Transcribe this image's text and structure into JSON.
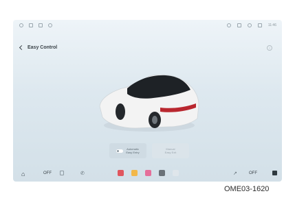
{
  "header": {
    "title": "Easy Control"
  },
  "status": {
    "clock": "11:46"
  },
  "controls": {
    "automatic_line1": "Automatic",
    "automatic_line2": "Easy Entry",
    "manual_line1": "Manual",
    "manual_line2": "Easy Exit"
  },
  "bottom": {
    "left_off": "OFF",
    "right_off": "OFF"
  },
  "caption": "OME03-1620",
  "icons": [
    "home-icon",
    "phone-icon",
    "seat-icon",
    "info-icon",
    "back-chevron-icon",
    "toggle-icon"
  ],
  "colors": {
    "screen_top": "#eef4f8",
    "screen_bottom": "#d3e0e8",
    "car": "#f3f3f3",
    "glass": "#1e2226"
  }
}
